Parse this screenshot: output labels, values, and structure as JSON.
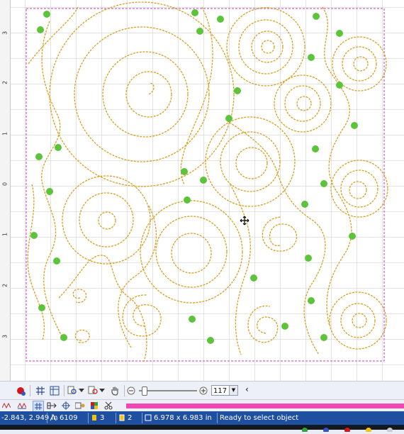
{
  "ruler": {
    "labels": [
      "3",
      "2",
      "1",
      "0",
      "1",
      "2",
      "3"
    ]
  },
  "zoom": {
    "value": "117 %"
  },
  "status": {
    "coords": "-2.843, 2.949 in",
    "stitch_count": "6109",
    "colors_count": "3",
    "objects_count": "2",
    "size": "6.978 x 6.983 in",
    "message": "Ready to select object"
  },
  "design": {
    "thread_color": "#d9a021",
    "hoop_color": "#d97bd8",
    "dot_color": "#5cc43a"
  },
  "colors": {
    "progress": "#ec49b3",
    "statusbar": "#1f4fa0"
  }
}
